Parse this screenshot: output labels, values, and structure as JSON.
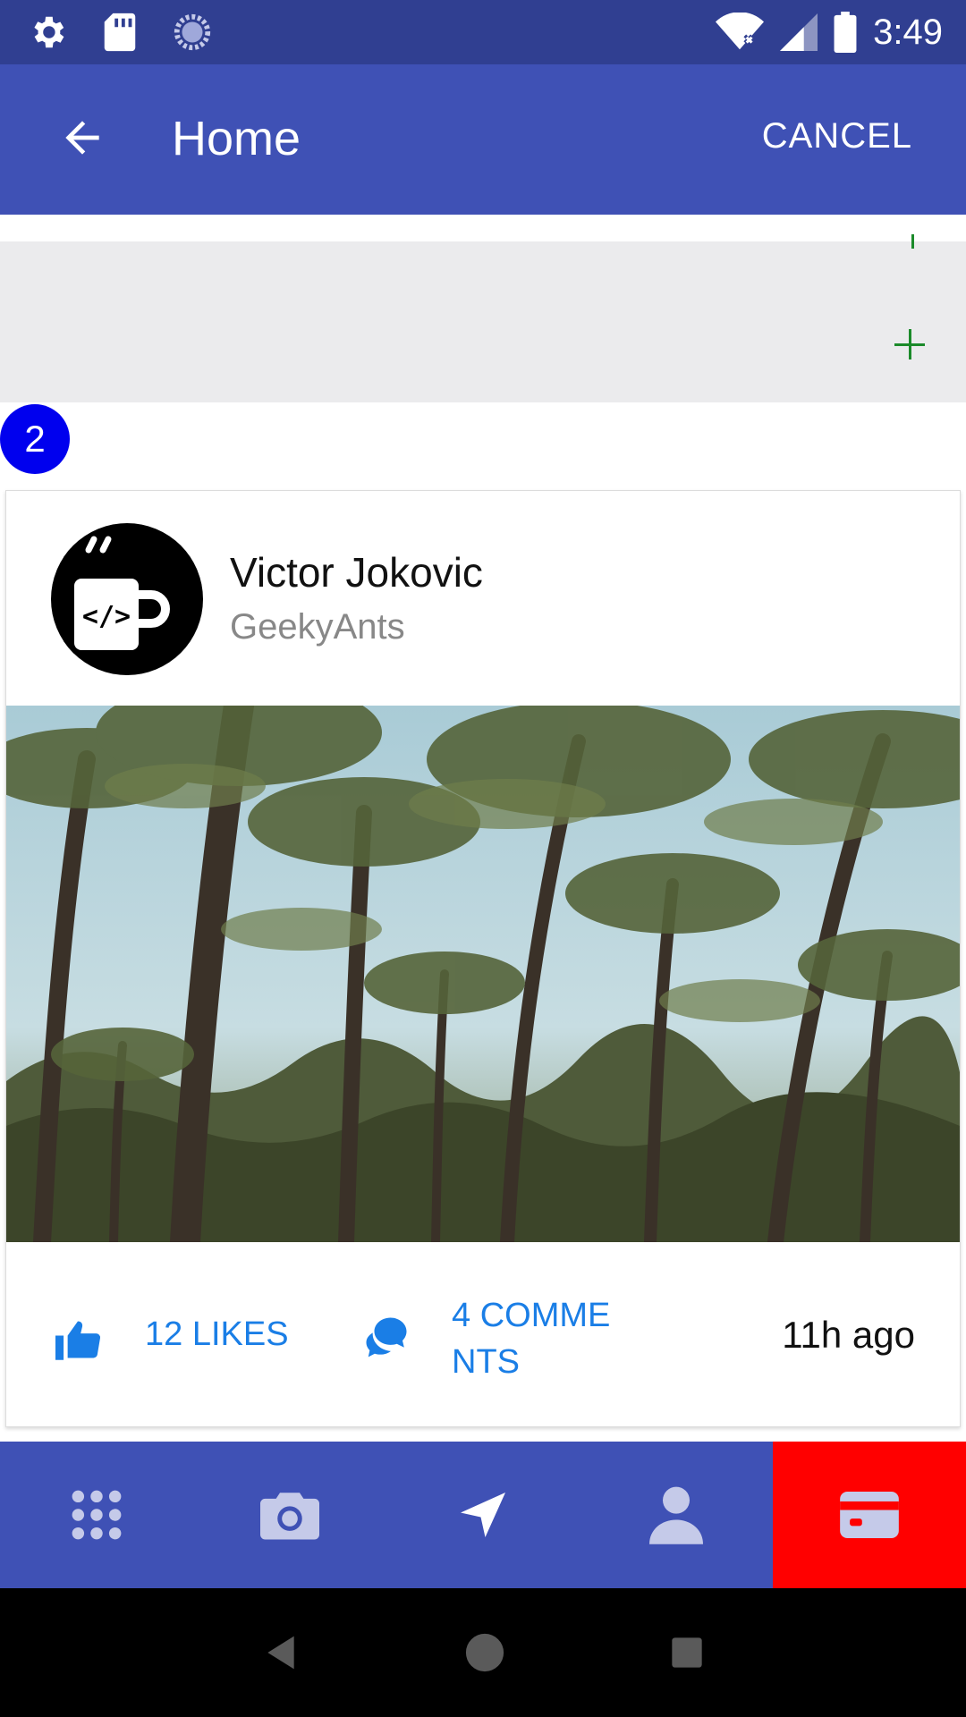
{
  "status_bar": {
    "time": "3:49",
    "left_icons": [
      "settings-icon",
      "sd-card-icon",
      "sync-icon"
    ],
    "right_icons": [
      "wifi-icon",
      "signal-icon",
      "battery-icon"
    ]
  },
  "app_bar": {
    "title": "Home",
    "cancel_label": "CANCEL",
    "back_icon": "arrow-left-icon"
  },
  "badge": {
    "count": "2"
  },
  "card": {
    "author_name": "Victor Jokovic",
    "author_org": "GeekyAnts",
    "likes_label": "12 LIKES",
    "comments_label": "4 COMMENTS",
    "time_label": "11h ago"
  },
  "tabs": [
    {
      "icon": "apps-grid-icon",
      "active": false
    },
    {
      "icon": "camera-icon",
      "active": false
    },
    {
      "icon": "navigate-icon",
      "active": false
    },
    {
      "icon": "person-icon",
      "active": false
    },
    {
      "icon": "card-icon",
      "active": true
    }
  ],
  "colors": {
    "status_bar": "#303f91",
    "primary": "#3f51b5",
    "accent_link": "#1a7ee6",
    "active_tab": "#ff0000",
    "badge": "#0000ee",
    "plus": "#1b8a2a"
  }
}
